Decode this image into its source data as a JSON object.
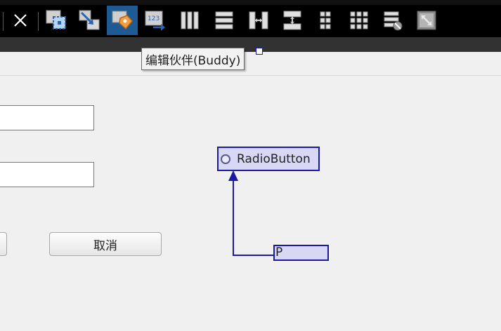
{
  "toolbar": {
    "buttons": [
      {
        "icon": "close-icon"
      },
      {
        "icon": "edit-widgets-icon"
      },
      {
        "icon": "edit-signals-slots-icon"
      },
      {
        "icon": "edit-buddies-icon",
        "active": true
      },
      {
        "icon": "edit-tab-order-icon"
      },
      {
        "icon": "layout-horizontal-icon"
      },
      {
        "icon": "layout-vertical-icon"
      },
      {
        "icon": "layout-horizontal-splitter-icon"
      },
      {
        "icon": "layout-vertical-splitter-icon"
      },
      {
        "icon": "layout-form-icon"
      },
      {
        "icon": "layout-grid-icon"
      },
      {
        "icon": "break-layout-icon"
      },
      {
        "icon": "adjust-size-icon"
      }
    ],
    "active_color": "#1e5a94"
  },
  "tooltip": {
    "text": "编辑伙伴(Buddy)"
  },
  "form": {
    "cancel_button_label": "取消",
    "radio_button_label": "RadioButton",
    "buddy_label_text": "P"
  },
  "colors": {
    "selection_border": "#1a1aa8",
    "selection_fill": "#d8d8f5",
    "canvas_background": "#f0f0f0"
  }
}
